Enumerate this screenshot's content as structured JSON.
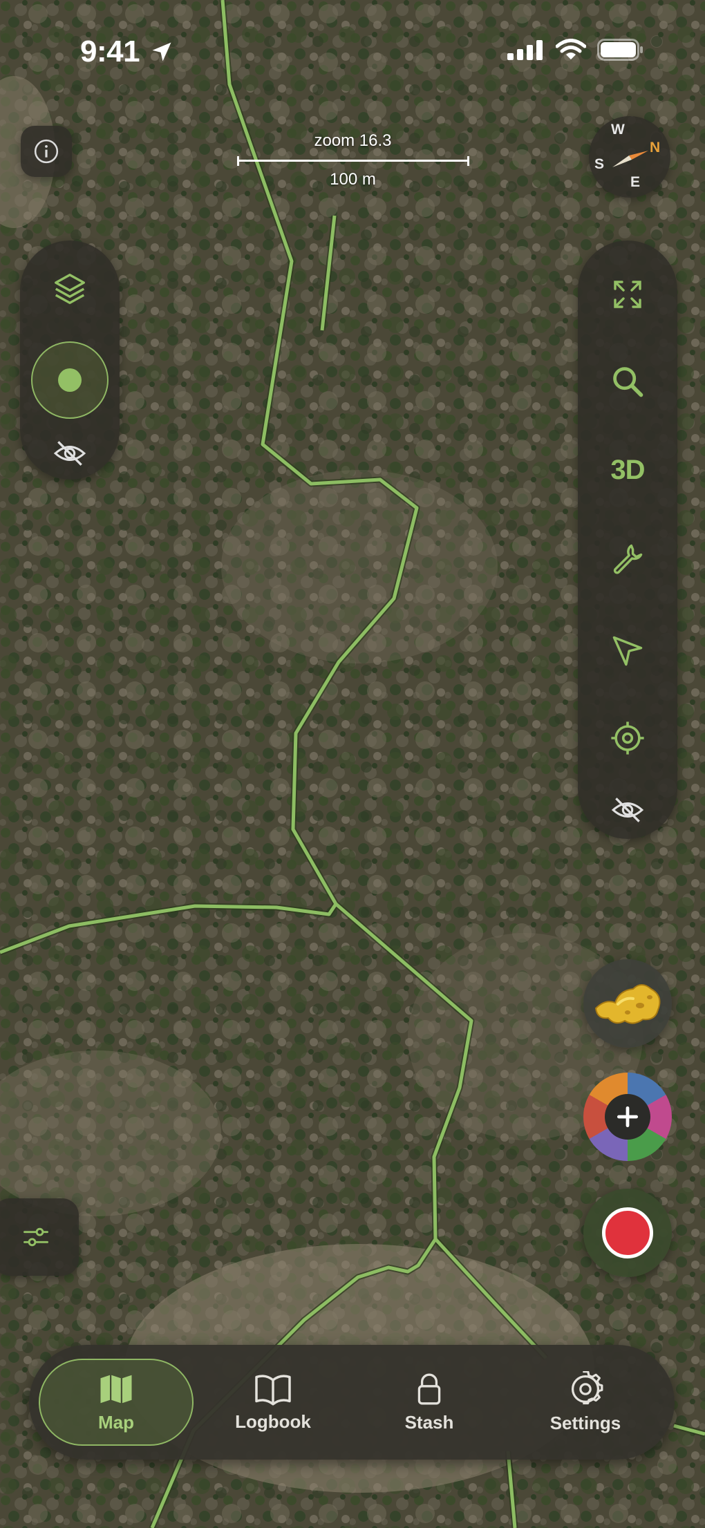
{
  "status_bar": {
    "time": "9:41",
    "icons": [
      "location-arrow-icon",
      "cellular-signal-icon",
      "wifi-icon",
      "battery-icon"
    ]
  },
  "map": {
    "basemap": "satellite",
    "trail_color": "#8dbd63"
  },
  "scale_bar": {
    "zoom_label": "zoom 16.3",
    "distance_label": "100 m"
  },
  "compass": {
    "north": "N",
    "south": "S",
    "east": "E",
    "west": "W"
  },
  "left_toolbar": {
    "items": [
      "layers-icon",
      "location-dot-icon",
      "eye-slash-icon"
    ]
  },
  "right_toolbar": {
    "items": [
      "expand-icon",
      "search-icon",
      "3d",
      "wrench-icon",
      "navigation-arrow-icon",
      "crosshair-icon",
      "eye-slash-icon"
    ],
    "three_d_label": "3D"
  },
  "fab": {
    "items": [
      "gold-nugget-icon",
      "add-icon",
      "record-icon"
    ]
  },
  "tab_bar": {
    "active": "Map",
    "tabs": [
      {
        "label": "Map",
        "icon": "map-icon"
      },
      {
        "label": "Logbook",
        "icon": "book-icon"
      },
      {
        "label": "Stash",
        "icon": "lock-icon"
      },
      {
        "label": "Settings",
        "icon": "gear-icon"
      }
    ]
  },
  "colors": {
    "accent": "#93c065",
    "panel": "#302e28",
    "record": "#e0323c"
  }
}
